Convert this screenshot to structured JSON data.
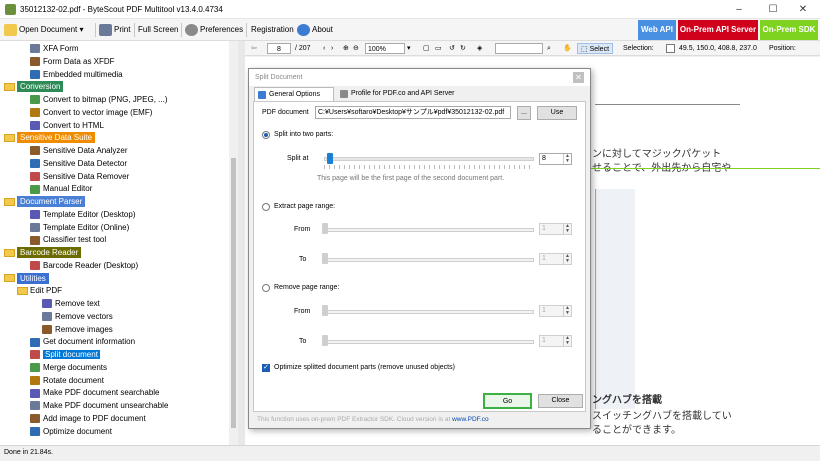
{
  "window": {
    "title": "35012132-02.pdf - ByteScout PDF Multitool v13.4.0.4734",
    "controls": [
      "–",
      "☐",
      "✕"
    ]
  },
  "toolbar": {
    "open_document": "Open Document",
    "print": "Print",
    "full_screen": "Full Screen",
    "preferences": "Preferences",
    "registration": "Registration",
    "about": "About",
    "web_api": "Web API",
    "on_prem_api": "On-Prem API Server",
    "on_prem_sdk": "On-Prem SDK",
    "colors": {
      "web_api": "#4a90e2",
      "on_prem_api": "#d0021b",
      "on_prem_sdk": "#7ed321"
    }
  },
  "viewer_toolbar": {
    "page": "8",
    "page_total": "/ 207",
    "zoom": "100%",
    "select": "Select",
    "selection_label": "Selection:",
    "selection_value": "49.5, 150.0, 408.8, 237.0",
    "position_label": "Position:"
  },
  "tree": {
    "items": [
      {
        "label": "XFA Form",
        "kind": "item",
        "icon": "xfa-icon"
      },
      {
        "label": "Form Data as XFDF",
        "kind": "item",
        "icon": "xfdf-icon"
      },
      {
        "label": "Embedded multimedia",
        "kind": "item",
        "icon": "media-icon"
      },
      {
        "label": "Conversion",
        "kind": "category",
        "color": "#2e8b57"
      },
      {
        "label": "Convert to bitmap (PNG, JPEG, ...)",
        "kind": "item",
        "icon": "bitmap-icon"
      },
      {
        "label": "Convert to vector image (EMF)",
        "kind": "item",
        "icon": "vector-icon"
      },
      {
        "label": "Convert to HTML",
        "kind": "item",
        "icon": "html-icon"
      },
      {
        "label": "Sensitive Data Suite",
        "kind": "category",
        "color": "#f08c00"
      },
      {
        "label": "Sensitive Data Analyzer",
        "kind": "item",
        "icon": "analyzer-icon"
      },
      {
        "label": "Sensitive Data Detector",
        "kind": "item",
        "icon": "detector-icon"
      },
      {
        "label": "Sensitive Data Remover",
        "kind": "item",
        "icon": "remover-icon"
      },
      {
        "label": "Manual Editor",
        "kind": "item",
        "icon": "editor-icon"
      },
      {
        "label": "Document Parser",
        "kind": "category",
        "color": "#4a7fd6"
      },
      {
        "label": "Template Editor (Desktop)",
        "kind": "item",
        "icon": "template-icon"
      },
      {
        "label": "Template Editor (Online)",
        "kind": "item",
        "icon": "template-online-icon"
      },
      {
        "label": "Classifier test tool",
        "kind": "item",
        "icon": "classifier-icon"
      },
      {
        "label": "Barcode Reader",
        "kind": "category",
        "color": "#6b6b00"
      },
      {
        "label": "Barcode Reader (Desktop)",
        "kind": "item",
        "icon": "barcode-icon"
      },
      {
        "label": "Utilities",
        "kind": "category",
        "color": "#3b6fd4"
      },
      {
        "label": "Edit PDF",
        "kind": "folder"
      },
      {
        "label": "Remove text",
        "kind": "subitem",
        "icon": "remove-text-icon"
      },
      {
        "label": "Remove vectors",
        "kind": "subitem",
        "icon": "remove-vectors-icon"
      },
      {
        "label": "Remove images",
        "kind": "subitem",
        "icon": "remove-images-icon"
      },
      {
        "label": "Get document information",
        "kind": "item",
        "icon": "info-icon"
      },
      {
        "label": "Split document",
        "kind": "item",
        "icon": "split-icon",
        "selected": true
      },
      {
        "label": "Merge documents",
        "kind": "item",
        "icon": "merge-icon"
      },
      {
        "label": "Rotate document",
        "kind": "item",
        "icon": "rotate-icon"
      },
      {
        "label": "Make PDF document searchable",
        "kind": "item",
        "icon": "searchable-icon"
      },
      {
        "label": "Make PDF document unsearchable",
        "kind": "item",
        "icon": "unsearchable-icon"
      },
      {
        "label": "Add image to PDF document",
        "kind": "item",
        "icon": "add-image-icon"
      },
      {
        "label": "Optimize document",
        "kind": "item",
        "icon": "optimize-icon"
      }
    ]
  },
  "document": {
    "line1": "ンに対してマジックパケット",
    "line2": "せることで、外出先から自宅や",
    "heading": "ングハブを搭載",
    "line3": "スイッチングハブを搭載してい",
    "line4": "ることができます。"
  },
  "dialog": {
    "title": "Split Document",
    "tab_general": "General Options",
    "tab_profile": "Profile for PDF.co and API Server",
    "pdf_document_label": "PDF document",
    "pdf_document_value": "C:¥Users¥softaro¥Desktop¥サンプル¥pdf¥35012132-02.pdf",
    "browse": "...",
    "use": "Use",
    "split_two_parts": "Split into two parts:",
    "split_at_label": "Split at",
    "split_at_value": "8",
    "split_hint": "This page will be the first page of the second document part.",
    "extract_range": "Extract page range:",
    "from_label": "From",
    "to_label": "To",
    "extract_from": "1",
    "extract_to": "1",
    "remove_range": "Remove page range:",
    "remove_from": "1",
    "remove_to": "1",
    "optimize_label": "Optimize splitted document parts (remove unused objects)",
    "go": "Go",
    "close": "Close",
    "info": "This function uses on-prem PDF Extractor SDK. Cloud version is at",
    "info_link": "www.PDF.co"
  },
  "status": {
    "text": "Done in 21.84s."
  }
}
